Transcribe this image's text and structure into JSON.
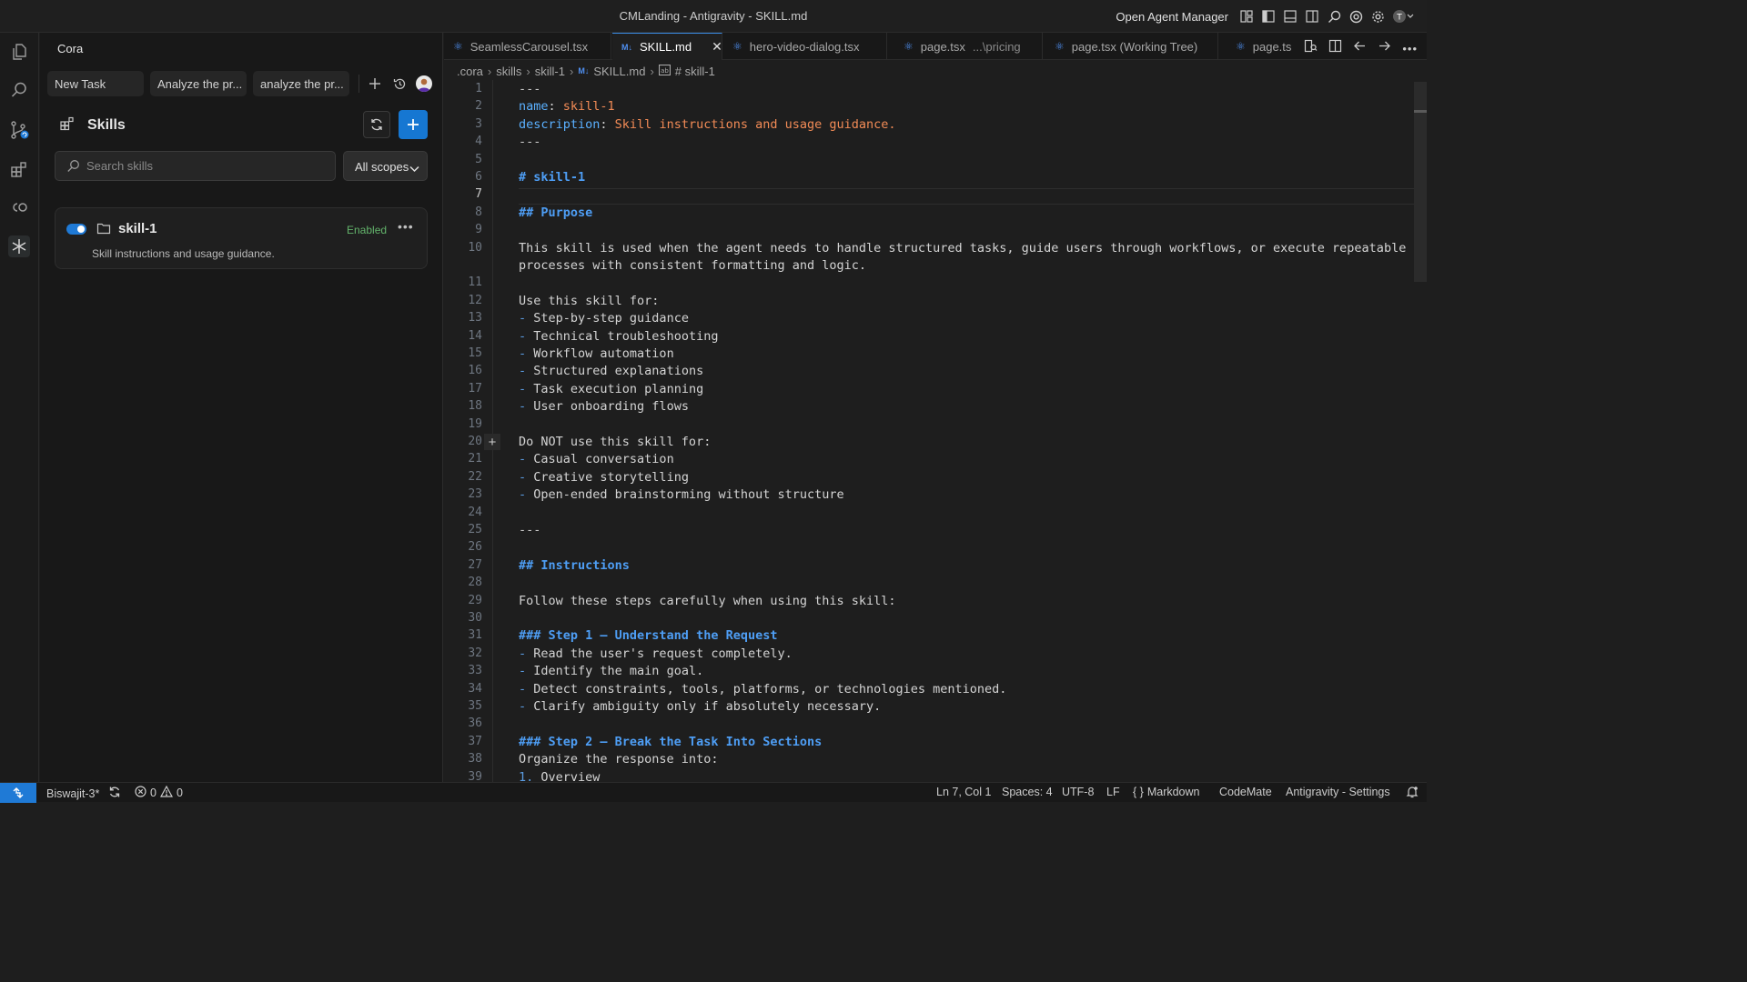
{
  "window": {
    "title": "CMLanding - Antigravity - SKILL.md",
    "open_agent_manager": "Open Agent Manager"
  },
  "activity_bar": {
    "icons": [
      "files-icon",
      "search-icon",
      "source-control-icon",
      "extensions-icon",
      "copilot-icon",
      "skills-icon"
    ]
  },
  "sidebar": {
    "title": "Cora",
    "task_tabs": [
      "New Task",
      "Analyze the pr...",
      "analyze the pr..."
    ],
    "skills_header": "Skills",
    "search_placeholder": "Search skills",
    "scope_selected": "All scopes",
    "skills": [
      {
        "name": "skill-1",
        "status": "Enabled",
        "description": "Skill instructions and usage guidance.",
        "enabled": true
      }
    ]
  },
  "editor_tabs": [
    {
      "label": "SeamlessCarousel.tsx",
      "path": "",
      "active": false
    },
    {
      "label": "SKILL.md",
      "path": "",
      "active": true
    },
    {
      "label": "hero-video-dialog.tsx",
      "path": "",
      "active": false
    },
    {
      "label": "page.tsx",
      "path": "...\\pricing",
      "active": false
    },
    {
      "label": "page.tsx (Working Tree)",
      "path": "",
      "active": false
    },
    {
      "label": "page.ts",
      "path": "",
      "active": false
    }
  ],
  "breadcrumb": {
    "parts": [
      ".cora",
      "skills",
      "skill-1",
      "SKILL.md",
      "# skill-1"
    ]
  },
  "code_lines": [
    {
      "n": "1",
      "t": "---"
    },
    {
      "n": "2",
      "t": "name: skill-1"
    },
    {
      "n": "3",
      "t": "description: Skill instructions and usage guidance."
    },
    {
      "n": "4",
      "t": "---"
    },
    {
      "n": "5",
      "t": ""
    },
    {
      "n": "6",
      "t": "# skill-1"
    },
    {
      "n": "7",
      "t": ""
    },
    {
      "n": "8",
      "t": "## Purpose"
    },
    {
      "n": "9",
      "t": ""
    },
    {
      "n": "10",
      "t": "This skill is used when the agent needs to handle structured tasks, guide users through workflows, or execute repeatable"
    },
    {
      "n": "",
      "t": "processes with consistent formatting and logic."
    },
    {
      "n": "11",
      "t": ""
    },
    {
      "n": "12",
      "t": "Use this skill for:"
    },
    {
      "n": "13",
      "t": "- Step-by-step guidance"
    },
    {
      "n": "14",
      "t": "- Technical troubleshooting"
    },
    {
      "n": "15",
      "t": "- Workflow automation"
    },
    {
      "n": "16",
      "t": "- Structured explanations"
    },
    {
      "n": "17",
      "t": "- Task execution planning"
    },
    {
      "n": "18",
      "t": "- User onboarding flows"
    },
    {
      "n": "19",
      "t": ""
    },
    {
      "n": "20",
      "t": "Do NOT use this skill for:"
    },
    {
      "n": "21",
      "t": "- Casual conversation"
    },
    {
      "n": "22",
      "t": "- Creative storytelling"
    },
    {
      "n": "23",
      "t": "- Open-ended brainstorming without structure"
    },
    {
      "n": "24",
      "t": ""
    },
    {
      "n": "25",
      "t": "---"
    },
    {
      "n": "26",
      "t": ""
    },
    {
      "n": "27",
      "t": "## Instructions"
    },
    {
      "n": "28",
      "t": ""
    },
    {
      "n": "29",
      "t": "Follow these steps carefully when using this skill:"
    },
    {
      "n": "30",
      "t": ""
    },
    {
      "n": "31",
      "t": "### Step 1 — Understand the Request"
    },
    {
      "n": "32",
      "t": "- Read the user's request completely."
    },
    {
      "n": "33",
      "t": "- Identify the main goal."
    },
    {
      "n": "34",
      "t": "- Detect constraints, tools, platforms, or technologies mentioned."
    },
    {
      "n": "35",
      "t": "- Clarify ambiguity only if absolutely necessary."
    },
    {
      "n": "36",
      "t": ""
    },
    {
      "n": "37",
      "t": "### Step 2 — Break the Task Into Sections"
    },
    {
      "n": "38",
      "t": "Organize the response into:"
    },
    {
      "n": "39",
      "t": "1. Overview"
    }
  ],
  "current_line": "7",
  "status_bar": {
    "branch": "Biswajit-3*",
    "errors": "0",
    "warnings": "0",
    "position": "Ln 7, Col 1",
    "spaces": "Spaces: 4",
    "encoding": "UTF-8",
    "eol": "LF",
    "language": "Markdown",
    "codemate": "CodeMate",
    "settings": "Antigravity - Settings"
  },
  "colors": {
    "accent": "#1f7ad6",
    "enabled": "#63b36b",
    "md_key": "#5ab0ff",
    "md_value": "#f28b56",
    "md_heading": "#4e9ef5"
  }
}
